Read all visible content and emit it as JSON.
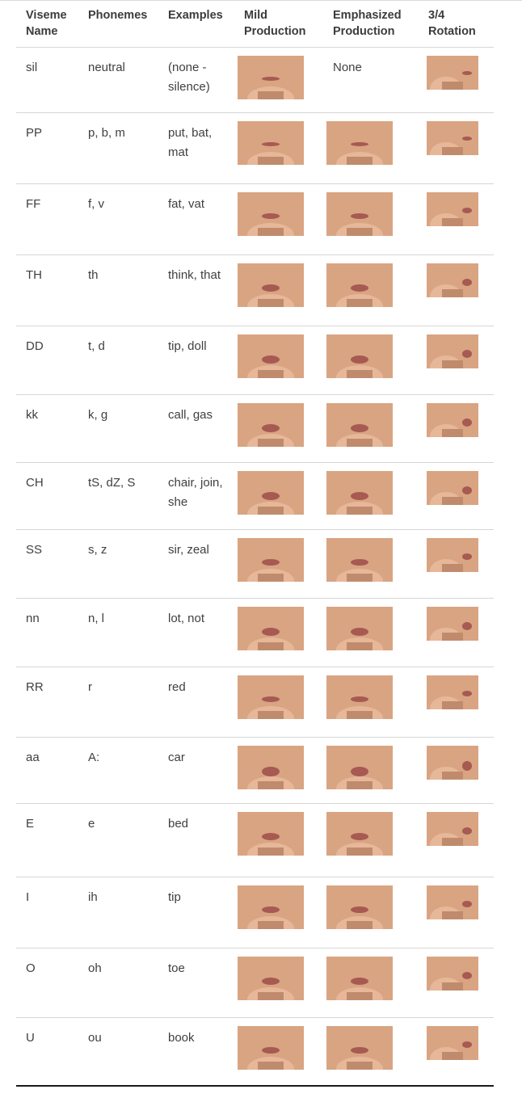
{
  "table": {
    "headers": [
      {
        "line1": "Viseme",
        "line2": "Name"
      },
      {
        "line1": "Phonemes",
        "line2": ""
      },
      {
        "line1": "Examples",
        "line2": ""
      },
      {
        "line1": "Mild",
        "line2": "Production"
      },
      {
        "line1": "Emphasized",
        "line2": "Production"
      },
      {
        "line1": "3/4",
        "line2": "Rotation"
      }
    ],
    "rows": [
      {
        "name": "sil",
        "phonemes": "neutral",
        "examples": "(none - silence)",
        "emphasized_text": "None",
        "emphasized_image": false,
        "mouth_open": 0.1
      },
      {
        "name": "PP",
        "phonemes": "p, b, m",
        "examples": "put, bat, mat",
        "emphasized_text": "",
        "emphasized_image": true,
        "mouth_open": 0.05
      },
      {
        "name": "FF",
        "phonemes": "f, v",
        "examples": "fat, vat",
        "emphasized_text": "",
        "emphasized_image": true,
        "mouth_open": 0.3
      },
      {
        "name": "TH",
        "phonemes": "th",
        "examples": "think, that",
        "emphasized_text": "",
        "emphasized_image": true,
        "mouth_open": 0.5
      },
      {
        "name": "DD",
        "phonemes": "t, d",
        "examples": "tip, doll",
        "emphasized_text": "",
        "emphasized_image": true,
        "mouth_open": 0.6
      },
      {
        "name": "kk",
        "phonemes": "k, g",
        "examples": "call, gas",
        "emphasized_text": "",
        "emphasized_image": true,
        "mouth_open": 0.6
      },
      {
        "name": "CH",
        "phonemes": "tS, dZ, S",
        "examples": "chair, join, she",
        "emphasized_text": "",
        "emphasized_image": true,
        "mouth_open": 0.6
      },
      {
        "name": "SS",
        "phonemes": "s, z",
        "examples": "sir, zeal",
        "emphasized_text": "",
        "emphasized_image": true,
        "mouth_open": 0.4
      },
      {
        "name": "nn",
        "phonemes": "n, l",
        "examples": "lot, not",
        "emphasized_text": "",
        "emphasized_image": true,
        "mouth_open": 0.6
      },
      {
        "name": "RR",
        "phonemes": "r",
        "examples": "red",
        "emphasized_text": "",
        "emphasized_image": true,
        "mouth_open": 0.3
      },
      {
        "name": "aa",
        "phonemes": "A:",
        "examples": "car",
        "emphasized_text": "",
        "emphasized_image": true,
        "mouth_open": 0.8
      },
      {
        "name": "E",
        "phonemes": "e",
        "examples": "bed",
        "emphasized_text": "",
        "emphasized_image": true,
        "mouth_open": 0.5
      },
      {
        "name": "I",
        "phonemes": "ih",
        "examples": "tip",
        "emphasized_text": "",
        "emphasized_image": true,
        "mouth_open": 0.4
      },
      {
        "name": "O",
        "phonemes": "oh",
        "examples": "toe",
        "emphasized_text": "",
        "emphasized_image": true,
        "mouth_open": 0.5
      },
      {
        "name": "U",
        "phonemes": "ou",
        "examples": "book",
        "emphasized_text": "",
        "emphasized_image": true,
        "mouth_open": 0.4
      }
    ]
  },
  "colors": {
    "skin": "#d9a482",
    "skin_light": "#e7b799",
    "lips": "#a65a52",
    "rule": "#d6d6d6",
    "bottom_rule": "#1a1a1a"
  }
}
